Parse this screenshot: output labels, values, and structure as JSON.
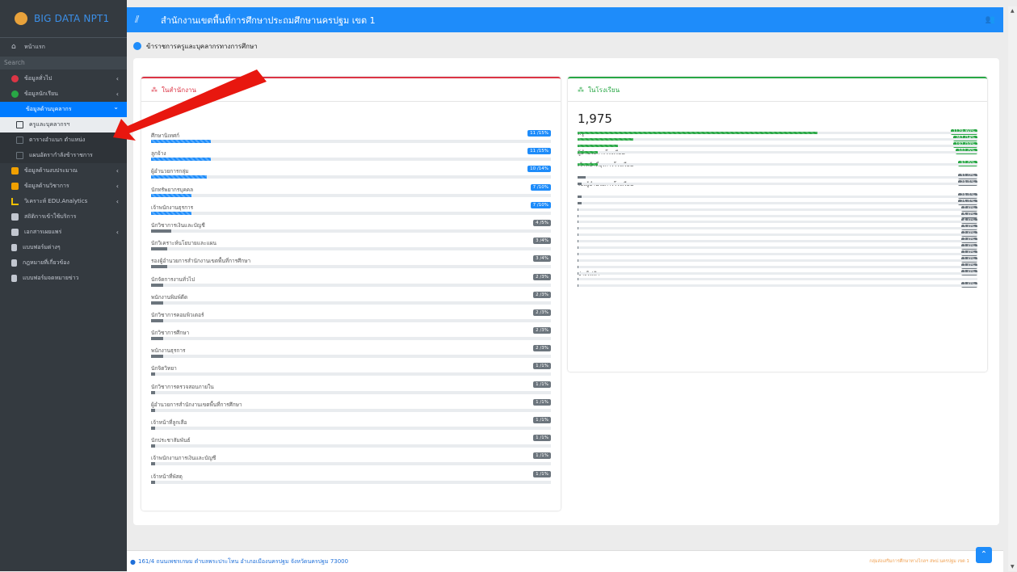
{
  "brand": "BIG DATA NPT1",
  "topbar": {
    "title": "สำนักงานเขตพื้นที่การศึกษาประถมศึกษานครปฐม เขต 1",
    "menu_icon": "hamburger-icon",
    "user_icon": "users-icon"
  },
  "sidebar": {
    "search_placeholder": "Search",
    "items": [
      {
        "label": "หน้าแรก",
        "icon": "home-icon",
        "color": "#c2c7d0"
      },
      {
        "label": "ข้อมูลทั่วไป",
        "icon": "target-icon",
        "color": "#dc3545",
        "chevron": "‹"
      },
      {
        "label": "ข้อมูลนักเรียน",
        "icon": "plus-circle-icon",
        "color": "#28a745",
        "chevron": "‹"
      },
      {
        "label": "ข้อมูลด้านบุคลากร",
        "icon": "",
        "color": "#ffffff",
        "chevron": "⌄",
        "active": true
      },
      {
        "label": "ครูและบุคลากรฯ",
        "icon": "square-icon",
        "sub": true
      },
      {
        "label": "ตารางอำแนก ตำแหน่ง",
        "icon": "square-icon",
        "sub2": true
      },
      {
        "label": "แผนอัตรากำลังข้าราชการ",
        "icon": "square-icon",
        "sub2": true
      },
      {
        "label": "ข้อมูลด้านงบประมาณ",
        "icon": "money-icon",
        "color": "#f0a000",
        "chevron": "‹"
      },
      {
        "label": "ข้อมูลด้านวิชาการ",
        "icon": "user-tie-icon",
        "color": "#f0a000",
        "chevron": "‹"
      },
      {
        "label": "วิเคราะห์ EDU.Analytics",
        "icon": "chart-line-icon",
        "color": "#f0c000",
        "chevron": "‹"
      },
      {
        "label": "สถิติการเข้าใช้บริการ",
        "icon": "thumbs-up-icon",
        "color": "#c2c7d0"
      },
      {
        "label": "เอกสารเผยแพร่",
        "icon": "id-card-icon",
        "color": "#c2c7d0",
        "chevron": "‹"
      },
      {
        "label": "แบบฟอร์มต่างๆ",
        "icon": "file-icon",
        "color": "#c2c7d0"
      },
      {
        "label": "กฎหมายที่เกี่ยวข้อง",
        "icon": "file-icon",
        "color": "#c2c7d0"
      },
      {
        "label": "แบบฟอร์มจดหมายข่าว",
        "icon": "file-icon",
        "color": "#c2c7d0"
      }
    ]
  },
  "page_title": "ข้าราชการครูและบุคลากรทางการศึกษา",
  "office_card": {
    "title": "ในสำนักงาน",
    "total": "",
    "rows": [
      {
        "label": "ศึกษานิเทศก์",
        "badge": "11 /15%",
        "pct": 15,
        "color": "blue"
      },
      {
        "label": "ลูกจ้าง",
        "badge": "11 /15%",
        "pct": 15,
        "color": "blue"
      },
      {
        "label": "ผู้อำนวยการกลุ่ม",
        "badge": "10 /14%",
        "pct": 14,
        "color": "blue"
      },
      {
        "label": "นักทรัพยากรบุคคล",
        "badge": "7 /10%",
        "pct": 10,
        "color": "blue"
      },
      {
        "label": "เจ้าพนักงานธุรการ",
        "badge": "7 /10%",
        "pct": 10,
        "color": "blue"
      },
      {
        "label": "นักวิชาการเงินและบัญชี",
        "badge": "4 /5%",
        "pct": 5,
        "color": "gray"
      },
      {
        "label": "นักวิเคราะห์นโยบายและแผน",
        "badge": "3 /4%",
        "pct": 4,
        "color": "gray"
      },
      {
        "label": "รองผู้อำนวยการสำนักงานเขตพื้นที่การศึกษา",
        "badge": "3 /4%",
        "pct": 4,
        "color": "gray"
      },
      {
        "label": "นักจัดการงานทั่วไป",
        "badge": "2 /3%",
        "pct": 3,
        "color": "gray"
      },
      {
        "label": "พนักงานพิมพ์ดีด",
        "badge": "2 /3%",
        "pct": 3,
        "color": "gray"
      },
      {
        "label": "นักวิชาการคอมพิวเตอร์",
        "badge": "2 /3%",
        "pct": 3,
        "color": "gray"
      },
      {
        "label": "นักวิชาการศึกษา",
        "badge": "2 /3%",
        "pct": 3,
        "color": "gray"
      },
      {
        "label": "พนักงานธุรการ",
        "badge": "2 /3%",
        "pct": 3,
        "color": "gray"
      },
      {
        "label": "นักจิตวิทยา",
        "badge": "1 /1%",
        "pct": 1,
        "color": "gray"
      },
      {
        "label": "นักวิชาการตรวจสอบภายใน",
        "badge": "1 /1%",
        "pct": 1,
        "color": "gray"
      },
      {
        "label": "ผู้อำนวยการสำนักงานเขตพื้นที่การศึกษา",
        "badge": "1 /1%",
        "pct": 1,
        "color": "gray"
      },
      {
        "label": "เจ้าหน้าที่ลูกเสือ",
        "badge": "1 /1%",
        "pct": 1,
        "color": "gray"
      },
      {
        "label": "นักประชาสัมพันธ์",
        "badge": "1 /1%",
        "pct": 1,
        "color": "gray"
      },
      {
        "label": "เจ้าพนักงานการเงินและบัญชี",
        "badge": "1 /1%",
        "pct": 1,
        "color": "gray"
      },
      {
        "label": "เจ้าหน้าที่พัสดุ",
        "badge": "1 /1%",
        "pct": 1,
        "color": "gray"
      }
    ]
  },
  "school_card": {
    "title": "ในโรงเรียน",
    "total": "1,975",
    "rows": [
      {
        "label": "ครู",
        "badge": "1179 /60%",
        "pct": 60,
        "color": "green"
      },
      {
        "label": "",
        "badge": "267 /14%",
        "pct": 14,
        "color": "green"
      },
      {
        "label": "",
        "badge": "192 /10%",
        "pct": 10,
        "color": "green"
      },
      {
        "label": "ผู้อำนวยการโรงเรียน",
        "badge": "102 /5%",
        "pct": 5,
        "color": "green"
      },
      {
        "label": "",
        "badge": "",
        "pct": 0,
        "color": "none"
      },
      {
        "label": "เจ้าหน้าที่ธุรการโรงเรียน",
        "badge": "92 /5%",
        "pct": 5,
        "color": "green"
      },
      {
        "label": "",
        "badge": "",
        "pct": 0,
        "color": "none"
      },
      {
        "label": "",
        "badge": "31 /2%",
        "pct": 2,
        "color": "gray"
      },
      {
        "label": "รองผู้อำนวยการโรงเรียน",
        "badge": "29 /1%",
        "pct": 1,
        "color": "gray"
      },
      {
        "label": "",
        "badge": "",
        "pct": 0,
        "color": "none"
      },
      {
        "label": "",
        "badge": "29 /1%",
        "pct": 1,
        "color": "gray"
      },
      {
        "label": "",
        "badge": "25 /1%",
        "pct": 1,
        "color": "gray"
      },
      {
        "label": "",
        "badge": "7 /0%",
        "pct": 0.3,
        "color": "gray"
      },
      {
        "label": "",
        "badge": "5 /0%",
        "pct": 0.3,
        "color": "gray"
      },
      {
        "label": "",
        "badge": "4 /0%",
        "pct": 0.3,
        "color": "gray"
      },
      {
        "label": "",
        "badge": "3 /0%",
        "pct": 0.3,
        "color": "gray"
      },
      {
        "label": "",
        "badge": "2 /0%",
        "pct": 0.3,
        "color": "gray"
      },
      {
        "label": "",
        "badge": "2 /0%",
        "pct": 0.3,
        "color": "gray"
      },
      {
        "label": "",
        "badge": "1 /0%",
        "pct": 0.3,
        "color": "gray"
      },
      {
        "label": "",
        "badge": "1 /0%",
        "pct": 0.3,
        "color": "gray"
      },
      {
        "label": "",
        "badge": "1 /0%",
        "pct": 0.3,
        "color": "gray"
      },
      {
        "label": "",
        "badge": "1 /0%",
        "pct": 0.3,
        "color": "gray"
      },
      {
        "label": "ช่างไฟฟ้า",
        "badge": "1 /0%",
        "pct": 0.3,
        "color": "gray"
      },
      {
        "label": "",
        "badge": "",
        "pct": 0.3,
        "color": "gray"
      },
      {
        "label": "",
        "badge": "1 /0%",
        "pct": 0.3,
        "color": "gray"
      }
    ]
  },
  "footer": {
    "address": "161/4 ถนนเพชรเกษม ตำบลพระประโทน อำเภอเมืองนครปฐม จังหวัดนครปฐม 73000",
    "copyright": "กลุ่มส่งเสริมการศึกษาทางไกลฯ สพป.นครปฐม เขต 1",
    "map_icon": "map-marker-icon"
  },
  "annotation": {
    "type": "red-arrow",
    "target": "ครูและบุคลากรฯ"
  },
  "colors": {
    "topbar": "#1e8cfa",
    "sidebar": "#343a40",
    "active": "#007bff",
    "red": "#dc3545",
    "green": "#28a745"
  }
}
